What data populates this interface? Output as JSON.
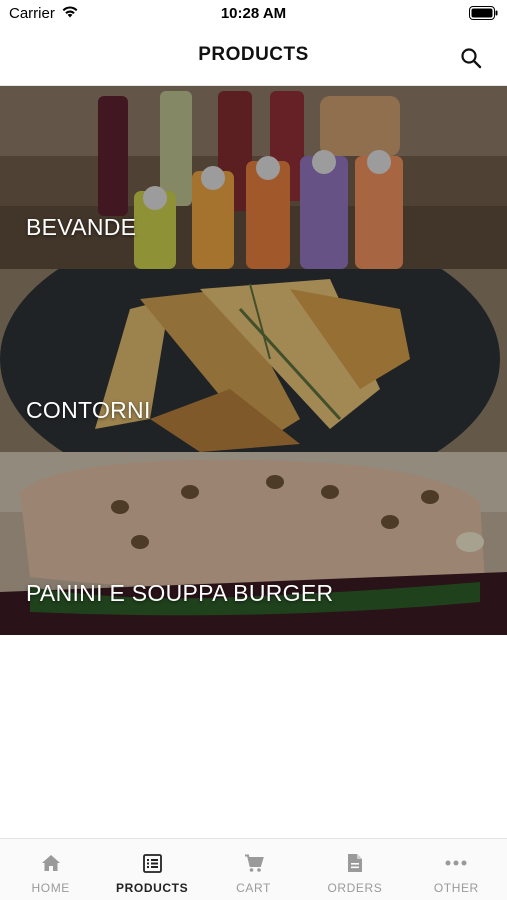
{
  "status_bar": {
    "carrier": "Carrier",
    "time": "10:28 AM"
  },
  "header": {
    "title": "PRODUCTS",
    "search_icon": "search-icon"
  },
  "categories": [
    {
      "label": "BEVANDE"
    },
    {
      "label": "CONTORNI"
    },
    {
      "label": "PANINI E SOUPPA BURGER"
    }
  ],
  "tab_bar": {
    "active": "PRODUCTS",
    "tabs": [
      {
        "label": "HOME",
        "icon": "home-icon"
      },
      {
        "label": "PRODUCTS",
        "icon": "list-icon"
      },
      {
        "label": "CART",
        "icon": "cart-icon"
      },
      {
        "label": "ORDERS",
        "icon": "document-icon"
      },
      {
        "label": "OTHER",
        "icon": "more-icon"
      }
    ]
  },
  "colors": {
    "tab_active": "#222222",
    "tab_inactive": "#9a9a9a",
    "overlay_text": "#ffffff"
  }
}
